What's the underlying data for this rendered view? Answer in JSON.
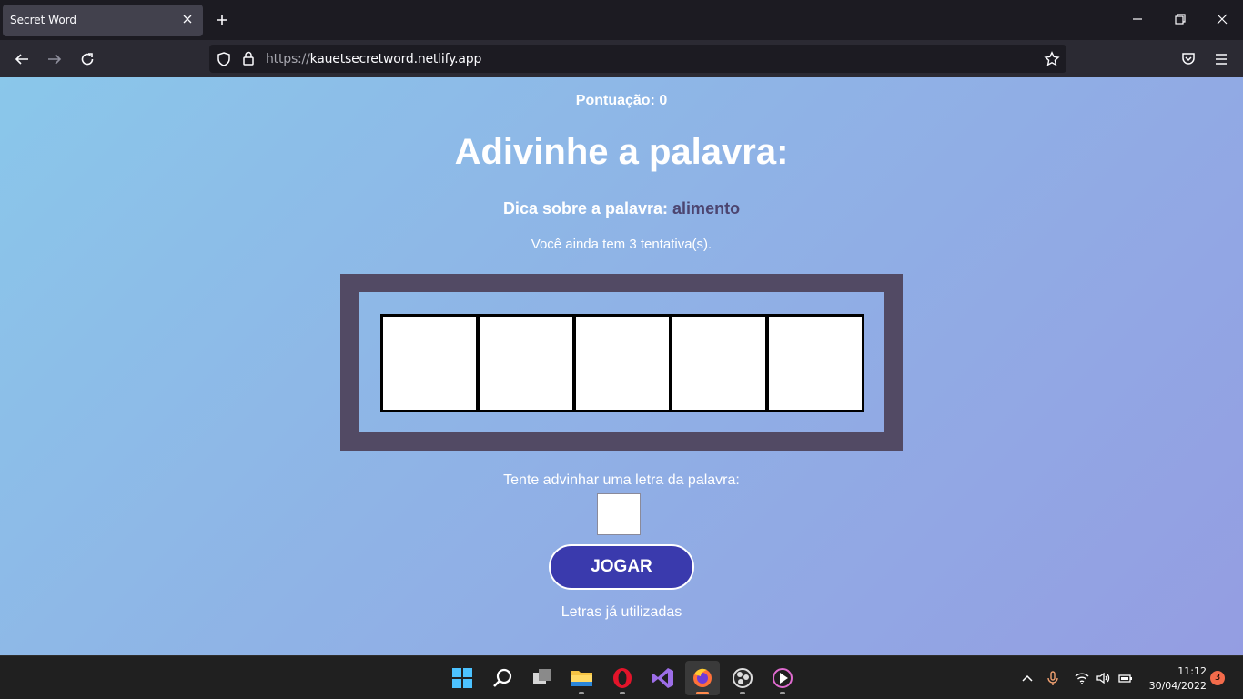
{
  "browser": {
    "tab_title": "Secret Word",
    "url_protocol": "https://",
    "url_host": "kauetsecretword.netlify.app"
  },
  "page": {
    "score_label": "Pontuação: 0",
    "headline": "Adivinhe a palavra:",
    "hint_label": "Dica sobre a palavra:",
    "hint_value": "alimento",
    "tries_text": "Você ainda tem 3 tentativa(s).",
    "letter_slots": 5,
    "guess_label": "Tente advinhar uma letra da palavra:",
    "guess_value": "",
    "play_button": "JOGAR",
    "used_letters_label": "Letras já utilizadas"
  },
  "taskbar": {
    "apps": [
      "start-icon",
      "search-icon",
      "task-view-icon",
      "file-explorer-icon",
      "opera-icon",
      "visual-studio-icon",
      "firefox-icon",
      "obs-icon",
      "media-player-icon"
    ],
    "active_app": "firefox-icon",
    "time": "11:12",
    "date": "30/04/2022",
    "notification_count": "3"
  },
  "colors": {
    "accent_button": "#3a3aad",
    "frame": "#524a64",
    "hint_value": "#4c4570"
  }
}
